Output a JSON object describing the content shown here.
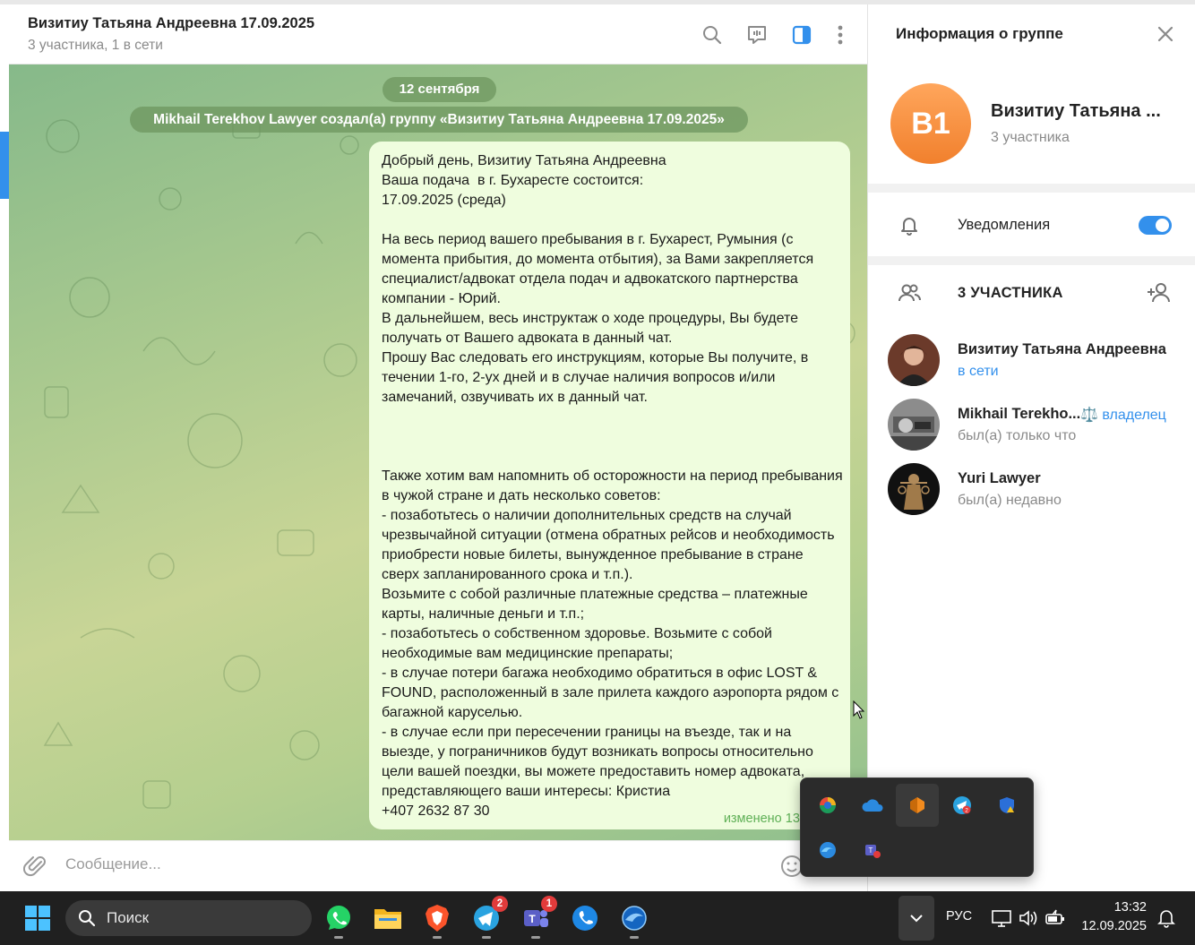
{
  "chat": {
    "title": "Визитиу Татьяна Андреевна 17.09.2025",
    "subtitle": "3 участника, 1 в сети",
    "date_label": "12 сентября",
    "service_message": "Mikhail Terekhov Lawyer создал(а) группу «Визитиу Татьяна Андреевна 17.09.2025»",
    "message_text": "Добрый день, Визитиу Татьяна Андреевна\nВаша подача  в г. Бухаресте состоится:\n17.09.2025 (среда)\n\nНа весь период вашего пребывания в г. Бухарест, Румыния (с момента прибытия, до момента отбытия), за Вами закрепляется специалист/адвокат отдела подач и адвокатского партнерства компании - Юрий.\nВ дальнейшем, весь инструктаж о ходе процедуры, Вы будете получать от Вашего адвоката в данный чат.\nПрошу Вас следовать его инструкциям, которые Вы получите, в течении 1-го, 2-ух дней и в случае наличия вопросов и/или замечаний, озвучивать их в данный чат.\n\n\n\nТакже хотим вам напомнить об осторожности на период пребывания в чужой стране и дать несколько советов:\n- позаботьтесь о наличии дополнительных средств на случай чрезвычайной ситуации (отмена обратных рейсов и необходимость приобрести новые билеты, вынужденное пребывание в стране сверх запланированного срока и т.п.).\nВозьмите с собой различные платежные средства – платежные карты, наличные деньги и т.п.;\n- позаботьтесь о собственном здоровье. Возьмите с собой необходимые вам медицинские препараты;\n- в случае потери багажа необходимо обратиться в офис LOST & FOUND, расположенный в зале прилета каждого аэропорта рядом с багажной каруселью.\n- в случае если при пересечении границы на въезде, так и на выезде, у пограничников будут возникать вопросы относительно цели вашей поездки, вы можете предоставить номер адвоката, представляющего ваши интересы: Кристиа\n+407 2632 87 30",
    "message_meta": "изменено 13:1",
    "compose_placeholder": "Сообщение..."
  },
  "group_info": {
    "title": "Информация о группе",
    "avatar_initials": "В1",
    "name": "Визитиу Татьяна ...",
    "count": "3 участника",
    "notifications_label": "Уведомления",
    "notifications_on": true,
    "members_header": "3 УЧАСТНИКА",
    "members": [
      {
        "name": "Визитиу Татьяна Андреевна",
        "status": "в сети",
        "badge": ""
      },
      {
        "name": "Mikhail Terekho...",
        "status": "был(а) только что",
        "badge": "⚖️ владелец"
      },
      {
        "name": "Yuri Lawyer",
        "status": "был(а) недавно",
        "badge": ""
      }
    ]
  },
  "taskbar": {
    "search_placeholder": "Поиск",
    "language": "РУС",
    "time": "13:32",
    "date": "12.09.2025",
    "telegram_badge": "2",
    "teams_badge": "1",
    "tray_telegram_badge": "2"
  },
  "colors": {
    "accent": "#3390ec",
    "bubble": "#effdde",
    "avatar_orange": "#f1802d",
    "taskbar": "#202020"
  }
}
